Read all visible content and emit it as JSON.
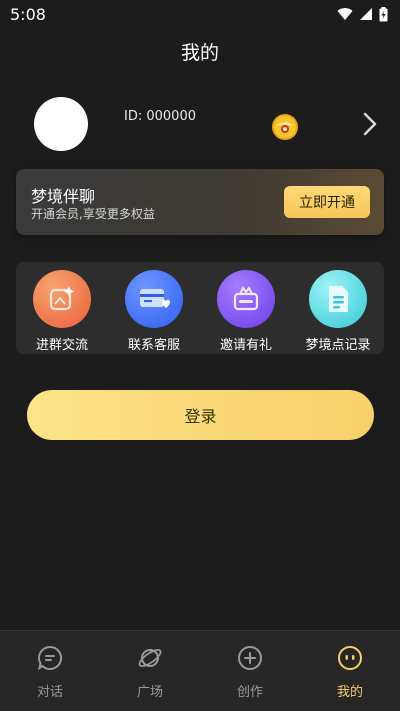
{
  "status": {
    "time": "5:08"
  },
  "header": {
    "title": "我的"
  },
  "profile": {
    "id_text": "ID: 000000"
  },
  "vip": {
    "title": "梦境伴聊",
    "subtitle": "开通会员,享受更多权益",
    "button": "立即开通"
  },
  "actions": [
    {
      "label": "进群交流",
      "icon": "group-chat-icon",
      "color": "#ef6f3a"
    },
    {
      "label": "联系客服",
      "icon": "customer-service-icon",
      "color": "#3b6cf5"
    },
    {
      "label": "邀请有礼",
      "icon": "gift-icon",
      "color": "#7b4ff0"
    },
    {
      "label": "梦境点记录",
      "icon": "record-icon",
      "color": "#4fd4de"
    }
  ],
  "login": {
    "label": "登录"
  },
  "nav": [
    {
      "label": "对话",
      "icon": "chat-icon"
    },
    {
      "label": "广场",
      "icon": "planet-icon"
    },
    {
      "label": "创作",
      "icon": "plus-circle-icon"
    },
    {
      "label": "我的",
      "icon": "profile-face-icon"
    }
  ],
  "colors": {
    "accent": "#f6cf6a",
    "background": "#1c1c1c"
  }
}
